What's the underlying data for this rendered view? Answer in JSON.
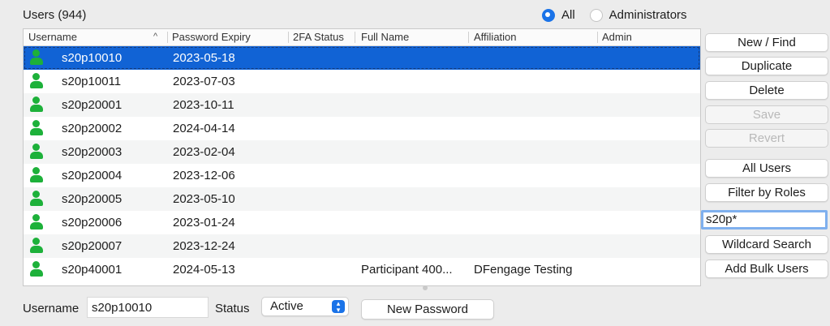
{
  "header": {
    "title": "Users (944)",
    "filter_all": "All",
    "filter_admins": "Administrators"
  },
  "table": {
    "columns": [
      "Username",
      "Password Expiry",
      "2FA Status",
      "Full Name",
      "Affiliation",
      "Admin"
    ],
    "rows": [
      {
        "username": "s20p10010",
        "expiry": "2023-05-18",
        "full_name": "",
        "affiliation": ""
      },
      {
        "username": "s20p10011",
        "expiry": "2023-07-03",
        "full_name": "",
        "affiliation": ""
      },
      {
        "username": "s20p20001",
        "expiry": "2023-10-11",
        "full_name": "",
        "affiliation": ""
      },
      {
        "username": "s20p20002",
        "expiry": "2024-04-14",
        "full_name": "",
        "affiliation": ""
      },
      {
        "username": "s20p20003",
        "expiry": "2023-02-04",
        "full_name": "",
        "affiliation": ""
      },
      {
        "username": "s20p20004",
        "expiry": "2023-12-06",
        "full_name": "",
        "affiliation": ""
      },
      {
        "username": "s20p20005",
        "expiry": "2023-05-10",
        "full_name": "",
        "affiliation": ""
      },
      {
        "username": "s20p20006",
        "expiry": "2023-01-24",
        "full_name": "",
        "affiliation": ""
      },
      {
        "username": "s20p20007",
        "expiry": "2023-12-24",
        "full_name": "",
        "affiliation": ""
      },
      {
        "username": "s20p40001",
        "expiry": "2024-05-13",
        "full_name": "Participant 400...",
        "affiliation": "DFengage Testing"
      }
    ]
  },
  "sidebar": {
    "new_find": "New / Find",
    "duplicate": "Duplicate",
    "delete": "Delete",
    "save": "Save",
    "revert": "Revert",
    "all_users": "All Users",
    "filter_by_roles": "Filter by Roles",
    "search_value": "s20p*",
    "wildcard_search": "Wildcard Search",
    "add_bulk_users": "Add Bulk Users"
  },
  "footer": {
    "username_label": "Username",
    "username_value": "s20p10010",
    "status_label": "Status",
    "status_value": "Active",
    "new_password": "New Password"
  },
  "colors": {
    "accent": "#1a73e8",
    "selection": "#1163d5",
    "user_icon": "#1db13a"
  },
  "icons": {
    "user": "user-icon",
    "sort": "chevron-up-icon",
    "select": "up-down-chevron-icon"
  }
}
